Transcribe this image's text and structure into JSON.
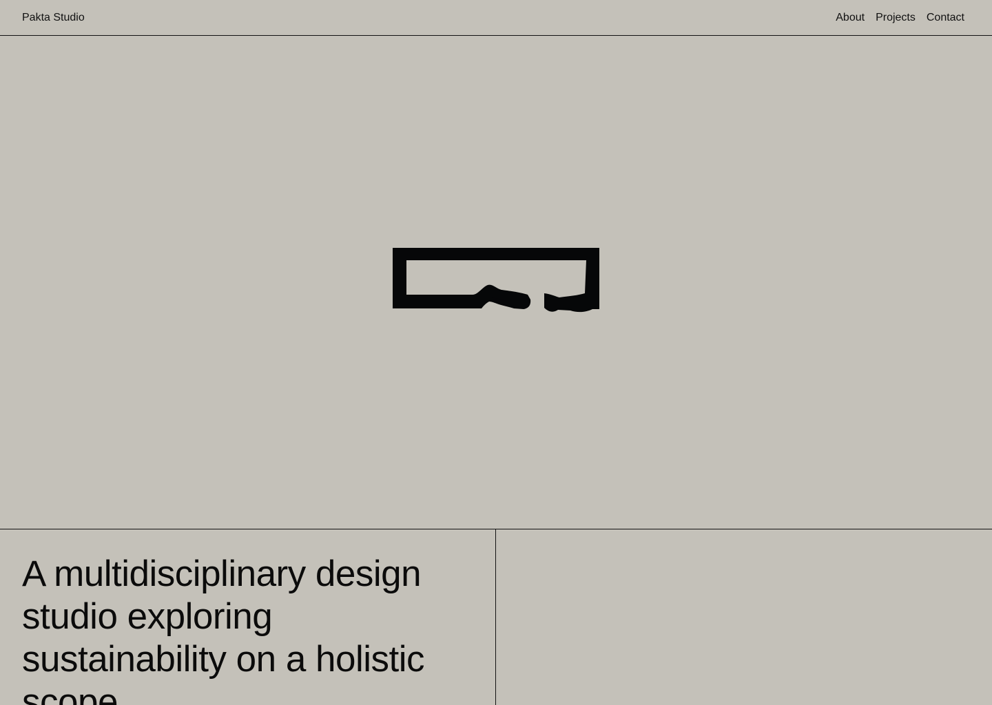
{
  "header": {
    "brand": "Pakta Studio",
    "nav": {
      "about": "About",
      "projects": "Projects",
      "contact": "Contact"
    }
  },
  "hero": {
    "logo_icon": "pakta-logo-icon"
  },
  "intro": {
    "tagline": "A multidisciplinary design studio exploring sustainability on a holistic scope."
  },
  "colors": {
    "background": "#c4c1b9",
    "text": "#0b0b0b",
    "rule": "#111111"
  }
}
